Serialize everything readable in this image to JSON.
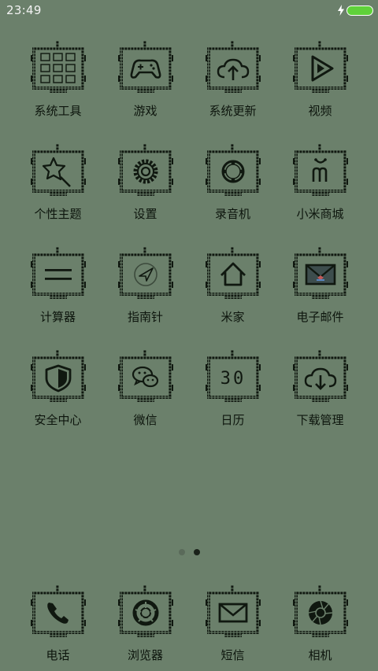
{
  "status_bar": {
    "time": "23:49"
  },
  "apps": [
    {
      "label": "系统工具",
      "icon": "folder-grid-icon"
    },
    {
      "label": "游戏",
      "icon": "gamepad-icon"
    },
    {
      "label": "系统更新",
      "icon": "cloud-upload-icon"
    },
    {
      "label": "视频",
      "icon": "play-icon"
    },
    {
      "label": "个性主题",
      "icon": "star-wand-icon"
    },
    {
      "label": "设置",
      "icon": "gear-icon"
    },
    {
      "label": "录音机",
      "icon": "recorder-icon"
    },
    {
      "label": "小米商城",
      "icon": "mi-bag-icon"
    },
    {
      "label": "计算器",
      "icon": "calculator-icon"
    },
    {
      "label": "指南针",
      "icon": "compass-icon"
    },
    {
      "label": "米家",
      "icon": "home-icon"
    },
    {
      "label": "电子邮件",
      "icon": "email-icon"
    },
    {
      "label": "安全中心",
      "icon": "shield-icon"
    },
    {
      "label": "微信",
      "icon": "wechat-icon"
    },
    {
      "label": "日历",
      "icon": "calendar-icon",
      "text": "30"
    },
    {
      "label": "下载管理",
      "icon": "cloud-download-icon"
    }
  ],
  "dock": [
    {
      "label": "电话",
      "icon": "phone-icon"
    },
    {
      "label": "浏览器",
      "icon": "browser-icon"
    },
    {
      "label": "短信",
      "icon": "message-icon"
    },
    {
      "label": "相机",
      "icon": "camera-icon"
    }
  ],
  "page_indicator": {
    "pages": 2,
    "current": 2
  }
}
